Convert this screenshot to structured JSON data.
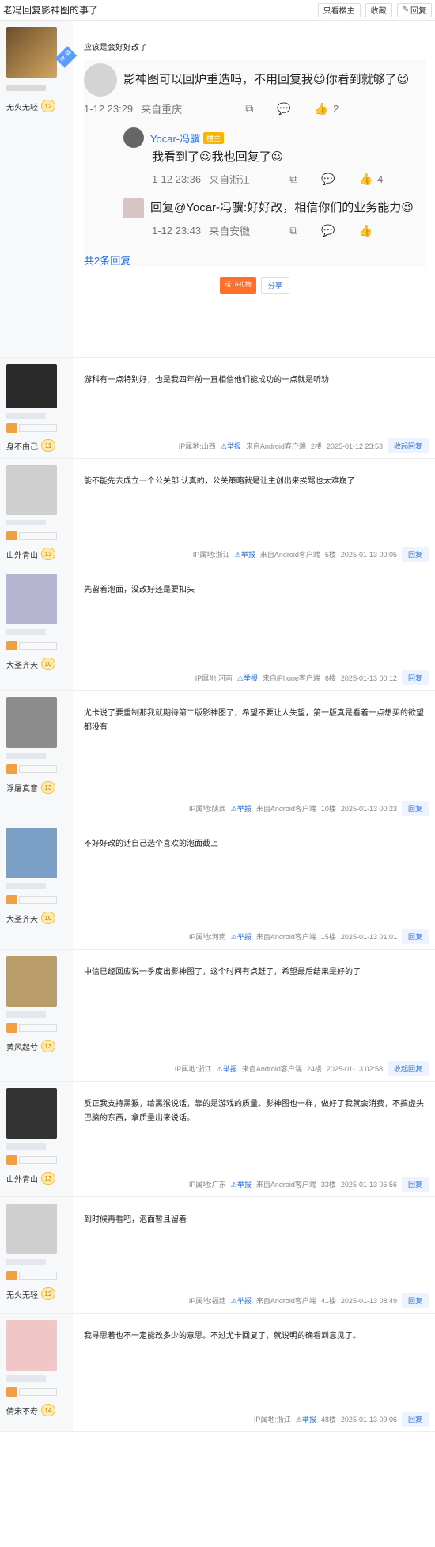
{
  "header": {
    "title": "老冯回复影神图的事了",
    "buttons": [
      "只看楼主",
      "收藏",
      "回复"
    ]
  },
  "floor1": {
    "author": "无火无轻",
    "level": "12",
    "tag": "楼主",
    "text": "应该是会好好改了",
    "subs": [
      {
        "text": "影神图可以回炉重造吗，不用回复我😉你看到就够了😉",
        "time": "1-12 23:29",
        "from": "来自重庆",
        "likes": "2"
      },
      {
        "user": "Yocar-冯骥",
        "vip": "楼主",
        "text": "我看到了😉我也回复了😉",
        "time": "1-12 23:36",
        "from": "来自浙江",
        "likes": "4"
      },
      {
        "text": "回复@Yocar-冯骥:好好改，相信你们的业务能力😉",
        "time": "1-12 23:43",
        "from": "来自安徽",
        "likes": ""
      }
    ],
    "more": "共2条回复",
    "gift": "送TA礼物",
    "share": "分享"
  },
  "floors": [
    {
      "author": "身不由己",
      "level": "11",
      "text": "游科有一点特别好，也是我四年前一直相信他们能成功的一点就是听劝",
      "ip": "IP属地:山西",
      "report": "举报",
      "client": "来自Android客户端",
      "floor": "2楼",
      "time": "2025-01-12 23:53",
      "reply": "收起回复",
      "h": 128
    },
    {
      "author": "山外青山",
      "level": "13",
      "text": "能不能先去成立一个公关部 认真的，公关策略就是让主创出来挨骂也太难崩了",
      "ip": "IP属地:浙江",
      "report": "举报",
      "client": "来自Android客户端",
      "floor": "5楼",
      "time": "2025-01-13 00:05",
      "reply": "回复",
      "h": 137
    },
    {
      "author": "大圣齐天",
      "level": "10",
      "text": "先留着泡面，没改好还是要扣头",
      "ip": "IP属地:河南",
      "report": "举报",
      "client": "来自iPhone客户端",
      "floor": "6楼",
      "time": "2025-01-13 00:12",
      "reply": "回复",
      "h": 156
    },
    {
      "author": "浮屠真意",
      "level": "13",
      "text": "尤卡说了要重制那我就期待第二版影神图了，希望不要让人失望，第一版真是看着一点想买的欲望都没有",
      "ip": "IP属地:陕西",
      "report": "举报",
      "client": "来自Android客户端",
      "floor": "10楼",
      "time": "2025-01-13 00:23",
      "reply": "回复",
      "h": 165
    },
    {
      "author": "大圣齐天",
      "level": "10",
      "text": "不好好改的话自己选个喜欢的泡面截上",
      "ip": "IP属地:河南",
      "report": "举报",
      "client": "来自Android客户端",
      "floor": "15楼",
      "time": "2025-01-13 01:01",
      "reply": "回复",
      "h": 162
    },
    {
      "author": "黄风起兮",
      "level": "13",
      "text": "中信已经回应说一季度出影神图了，这个时间有点赶了，希望最后结果是好的了",
      "ip": "IP属地:浙江",
      "report": "举报",
      "client": "来自Android客户端",
      "floor": "24楼",
      "time": "2025-01-13 02:58",
      "reply": "收起回复",
      "h": 167
    },
    {
      "author": "山外青山",
      "level": "13",
      "text": "反正我支持黑猴，给黑猴说话，靠的是游戏的质量。影神图也一样，做好了我就会消费，不搞虚头巴脑的东西，拿质量出来说话。",
      "ip": "IP属地:广东",
      "report": "举报",
      "client": "来自Android客户端",
      "floor": "33楼",
      "time": "2025-01-13 06:56",
      "reply": "回复",
      "h": 146
    },
    {
      "author": "无火无轻",
      "level": "12",
      "text": "到时候再看吧，泡面暂且留着",
      "ip": "IP属地:福建",
      "report": "举报",
      "client": "来自Android客户端",
      "floor": "41楼",
      "time": "2025-01-13 08:49",
      "reply": "回复",
      "h": 147
    },
    {
      "author": "倩宋不寿",
      "level": "14",
      "text": "我寻思着也不一定能改多少的意思。不过尤卡回复了，就说明的确看到意见了。",
      "ip": "IP属地:浙江",
      "report": "举报",
      "client": "",
      "floor": "48楼",
      "time": "2025-01-13 09:06",
      "reply": "回复",
      "h": 150
    }
  ],
  "colors": {
    "accent": "#2a6fdb",
    "gift": "#ff6f2a",
    "like": "#f25a24"
  }
}
